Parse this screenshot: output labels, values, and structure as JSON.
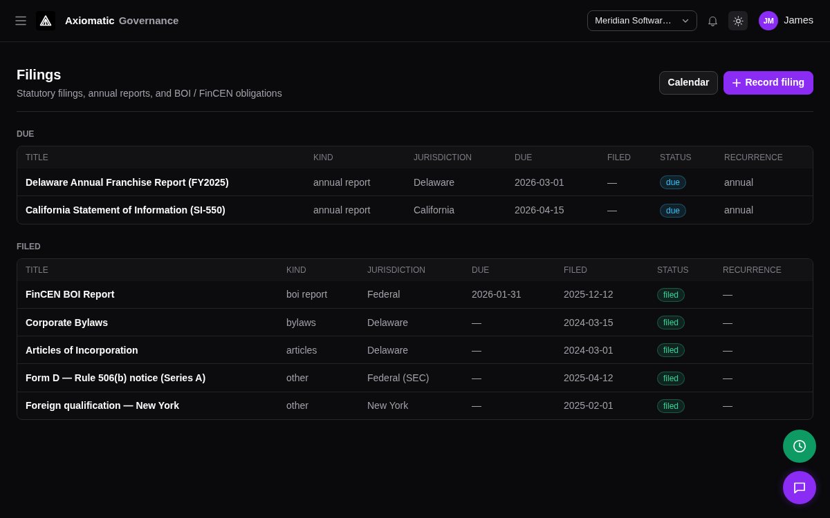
{
  "header": {
    "brand": "Axiomatic",
    "product": "Governance",
    "org_selector": {
      "value": "Meridian Softwar…"
    },
    "user": {
      "initials": "JM",
      "name": "James"
    }
  },
  "page": {
    "title": "Filings",
    "subtitle": "Statutory filings, annual reports, and BOI / FinCEN obligations",
    "buttons": [
      {
        "label": "Calendar",
        "kind": "secondary"
      },
      {
        "label": "Record filing",
        "kind": "primary"
      }
    ]
  },
  "sections": [
    {
      "label": "DUE",
      "table": {
        "columns": [
          "TITLE",
          "KIND",
          "JURISDICTION",
          "DUE",
          "FILED",
          "STATUS",
          "RECURRENCE"
        ],
        "rows": [
          {
            "cells": [
              "Delaware Annual Franchise Report (FY2025)",
              "annual report",
              "Delaware",
              "2026-03-01",
              "—",
              {
                "label": "due",
                "color": "#38bdf8"
              },
              "annual"
            ]
          },
          {
            "cells": [
              "California Statement of Information (SI-550)",
              "annual report",
              "California",
              "2026-04-15",
              "—",
              {
                "label": "due",
                "color": "#38bdf8"
              },
              "annual"
            ]
          }
        ]
      }
    },
    {
      "label": "FILED",
      "table": {
        "columns": [
          "TITLE",
          "KIND",
          "JURISDICTION",
          "DUE",
          "FILED",
          "STATUS",
          "RECURRENCE"
        ],
        "rows": [
          {
            "cells": [
              "FinCEN BOI Report",
              "boi report",
              "Federal",
              "2026-01-31",
              "2025-12-12",
              {
                "label": "filed",
                "color": "#34d399"
              },
              "—"
            ]
          },
          {
            "cells": [
              "Corporate Bylaws",
              "bylaws",
              "Delaware",
              "—",
              "2024-03-15",
              {
                "label": "filed",
                "color": "#34d399"
              },
              "—"
            ]
          },
          {
            "cells": [
              "Articles of Incorporation",
              "articles",
              "Delaware",
              "—",
              "2024-03-01",
              {
                "label": "filed",
                "color": "#34d399"
              },
              "—"
            ]
          },
          {
            "cells": [
              "Form D — Rule 506(b) notice (Series A)",
              "other",
              "Federal (SEC)",
              "—",
              "2025-04-12",
              {
                "label": "filed",
                "color": "#34d399"
              },
              "—"
            ]
          },
          {
            "cells": [
              "Foreign qualification — New York",
              "other",
              "New York",
              "—",
              "2025-02-01",
              {
                "label": "filed",
                "color": "#34d399"
              },
              "—"
            ]
          }
        ]
      }
    }
  ]
}
